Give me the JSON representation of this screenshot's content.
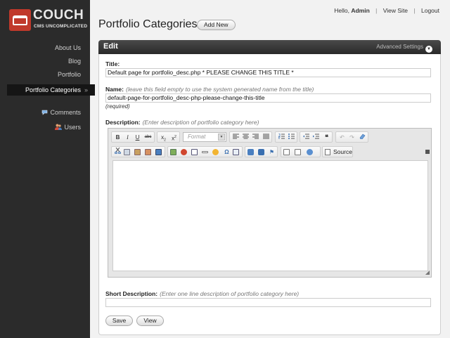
{
  "app": {
    "logo_word": "COUCH",
    "logo_tagline": "CMS UNCOMPLICATED",
    "brand_color": "#c0392b"
  },
  "sidebar": {
    "items": [
      {
        "label": "About Us"
      },
      {
        "label": "Blog"
      },
      {
        "label": "Portfolio"
      },
      {
        "label": "Portfolio Categories",
        "active": true
      },
      {
        "label": "Comments",
        "icon": "comment-icon"
      },
      {
        "label": "Users",
        "icon": "users-icon"
      }
    ],
    "active_chevron": "»"
  },
  "toplinks": {
    "hello": "Hello,",
    "user": "Admin",
    "view_site": "View Site",
    "logout": "Logout",
    "separator": "|"
  },
  "header": {
    "title": "Portfolio Categories",
    "add_new": "Add New"
  },
  "panel": {
    "title": "Edit",
    "advanced": "Advanced Settings"
  },
  "form": {
    "title_label": "Title:",
    "title_value": "Default page for portfolio_desc.php * PLEASE CHANGE THIS TITLE *",
    "name_label": "Name:",
    "name_hint": "(leave this field empty to use the system generated name from the title)",
    "name_value": "default-page-for-portfolio_desc-php-please-change-this-title",
    "name_required": "(required)",
    "description_label": "Description:",
    "description_hint": "(Enter description of portfolio category here)",
    "short_description_label": "Short Description:",
    "short_description_hint": "(Enter one line description of portfolio category here)",
    "short_description_value": ""
  },
  "editor": {
    "bold": "B",
    "italic": "I",
    "underline": "U",
    "strike": "abc",
    "subscript": "x",
    "subscript_sub": "2",
    "superscript": "x",
    "superscript_sup": "2",
    "format_placeholder": "Format",
    "blockquote": "❝",
    "source_label": "Source"
  },
  "buttons": {
    "save": "Save",
    "view": "View"
  }
}
